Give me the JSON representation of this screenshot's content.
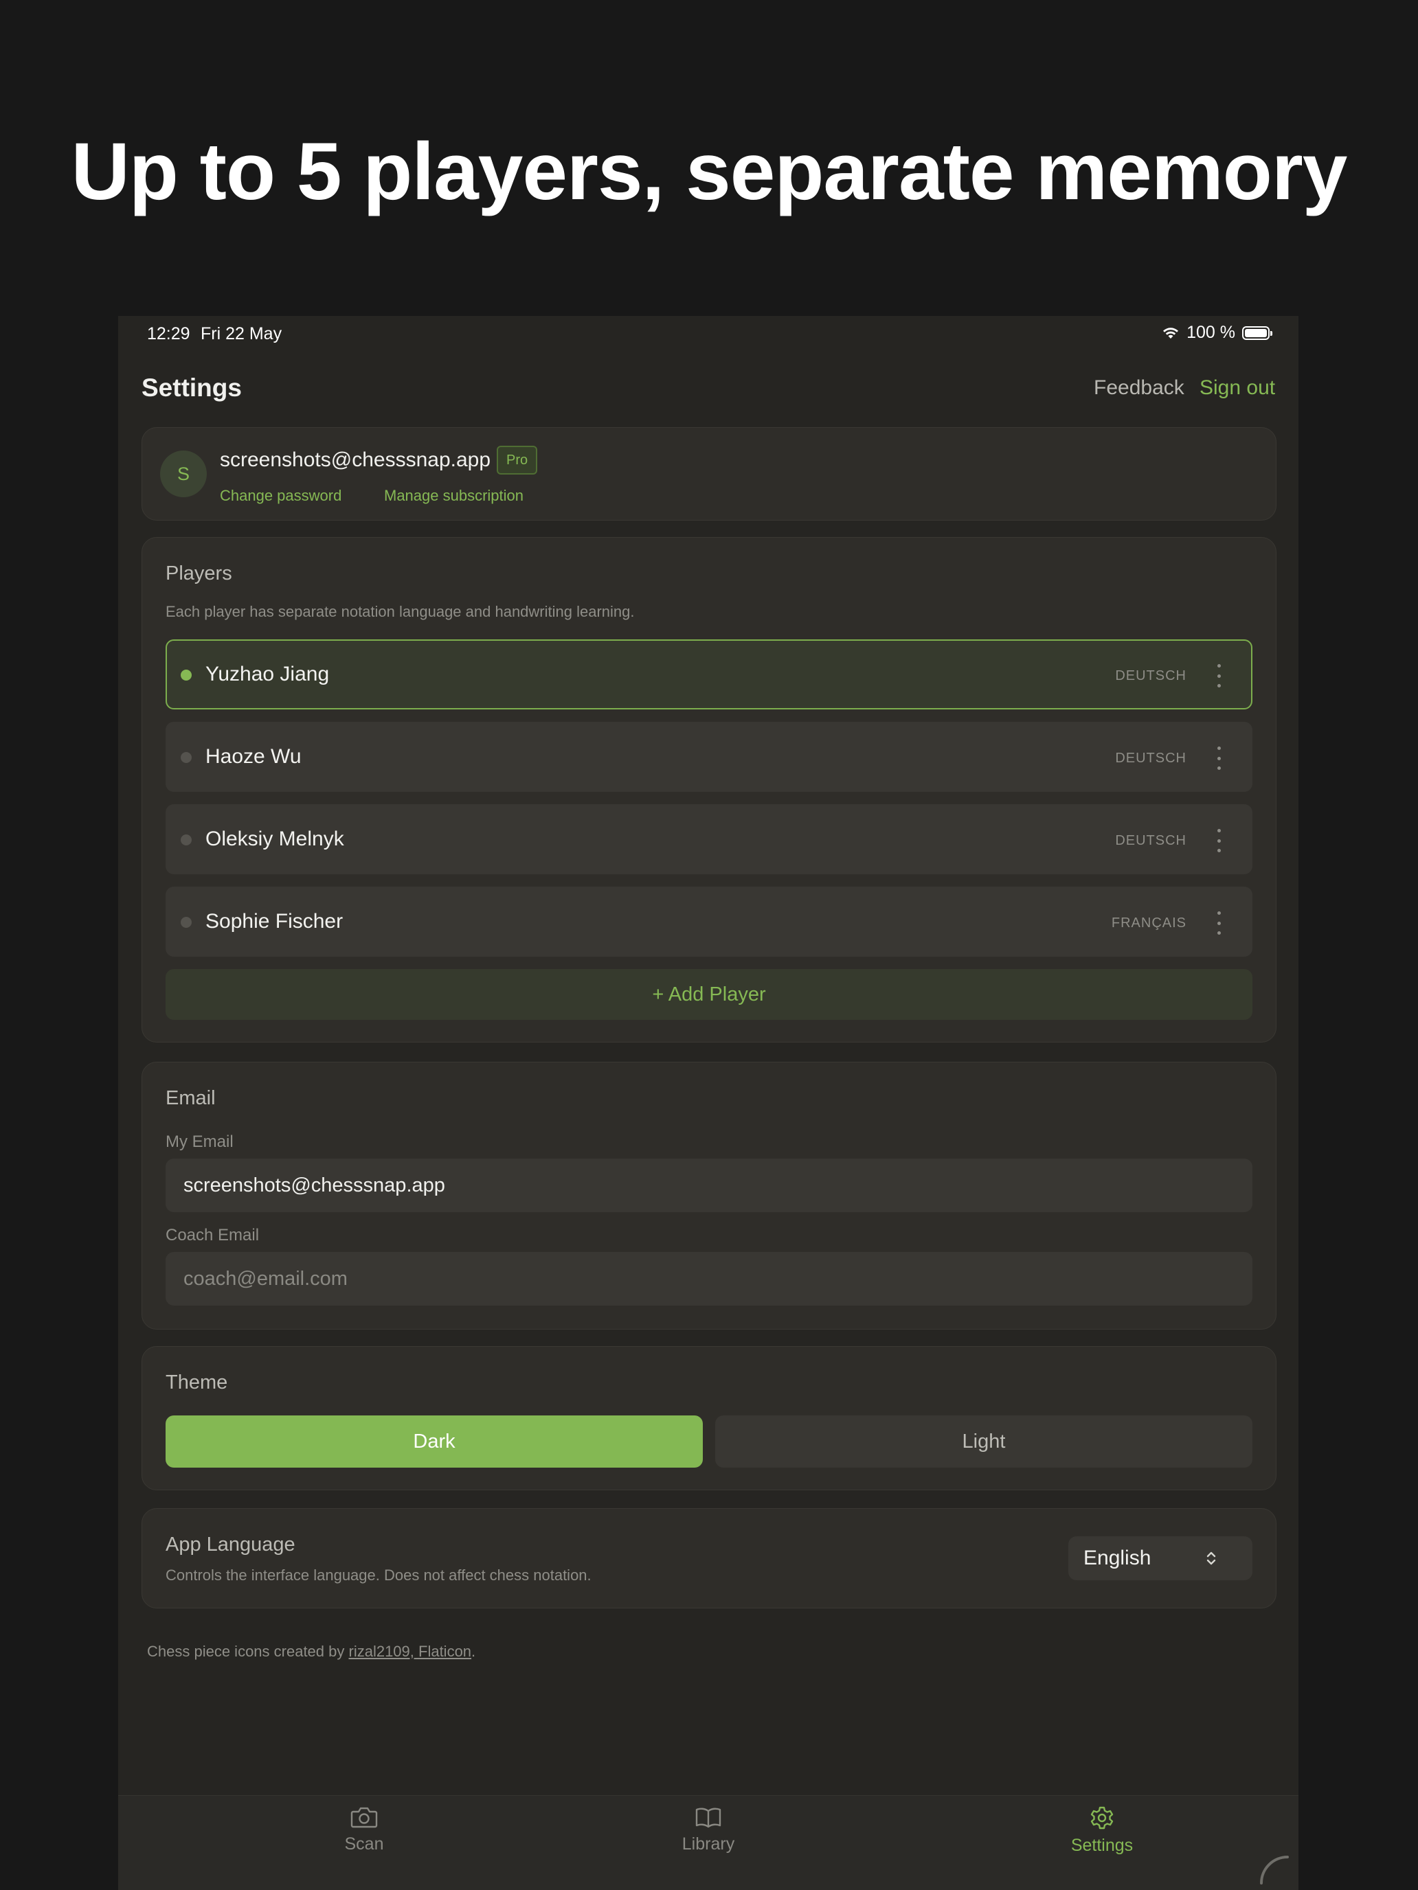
{
  "headline": "Up to 5 players, separate memory",
  "status_bar": {
    "time": "12:29",
    "date": "Fri 22 May",
    "battery": "100 %"
  },
  "nav": {
    "title": "Settings",
    "feedback": "Feedback",
    "sign_out": "Sign out"
  },
  "account": {
    "avatar_initial": "S",
    "email": "screenshots@chesssnap.app",
    "badge": "Pro",
    "change_password": "Change password",
    "manage_subscription": "Manage subscription"
  },
  "players": {
    "title": "Players",
    "subtitle": "Each player has separate notation language and handwriting learning.",
    "list": [
      {
        "name": "Yuzhao Jiang",
        "language": "DEUTSCH",
        "active": true
      },
      {
        "name": "Haoze Wu",
        "language": "DEUTSCH",
        "active": false
      },
      {
        "name": "Oleksiy Melnyk",
        "language": "DEUTSCH",
        "active": false
      },
      {
        "name": "Sophie Fischer",
        "language": "FRANÇAIS",
        "active": false
      }
    ],
    "add_label": "+ Add Player"
  },
  "email": {
    "title": "Email",
    "my_email_label": "My Email",
    "my_email_value": "screenshots@chesssnap.app",
    "coach_email_label": "Coach Email",
    "coach_email_placeholder": "coach@email.com"
  },
  "theme": {
    "title": "Theme",
    "dark": "Dark",
    "light": "Light",
    "selected": "Dark"
  },
  "language": {
    "title": "App Language",
    "subtitle": "Controls the interface language. Does not affect chess notation.",
    "selected": "English"
  },
  "credits": {
    "prefix": "Chess piece icons created by ",
    "link": "rizal2109, Flaticon",
    "suffix": "."
  },
  "tabs": [
    {
      "label": "Scan",
      "icon": "camera-icon"
    },
    {
      "label": "Library",
      "icon": "book-icon"
    },
    {
      "label": "Settings",
      "icon": "gear-icon",
      "active": true
    }
  ],
  "colors": {
    "accent": "#86b954",
    "background": "#262522",
    "card": "#2f2d29"
  }
}
